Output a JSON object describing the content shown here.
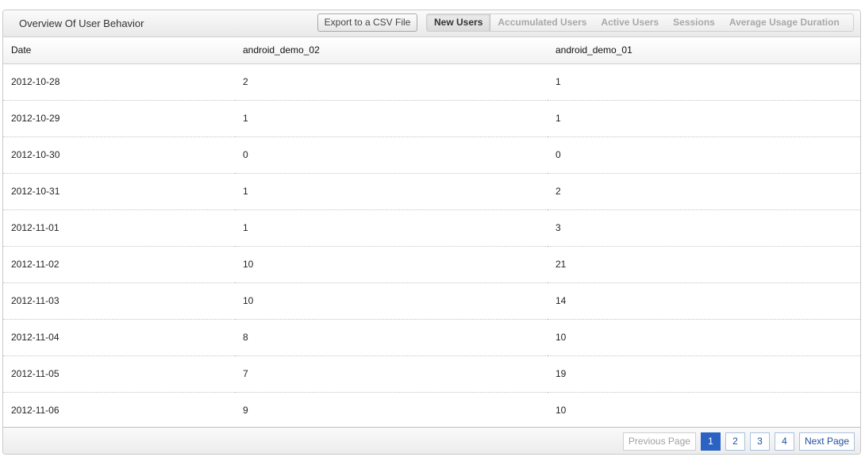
{
  "header": {
    "title": "Overview Of User Behavior",
    "export_label": "Export to a CSV File",
    "tabs": [
      {
        "label": "New Users",
        "active": true
      },
      {
        "label": "Accumulated Users",
        "active": false
      },
      {
        "label": "Active Users",
        "active": false
      },
      {
        "label": "Sessions",
        "active": false
      },
      {
        "label": "Average Usage Duration",
        "active": false
      }
    ]
  },
  "table": {
    "columns": [
      "Date",
      "android_demo_02",
      "android_demo_01"
    ],
    "rows": [
      [
        "2012-10-28",
        "2",
        "1"
      ],
      [
        "2012-10-29",
        "1",
        "1"
      ],
      [
        "2012-10-30",
        "0",
        "0"
      ],
      [
        "2012-10-31",
        "1",
        "2"
      ],
      [
        "2012-11-01",
        "1",
        "3"
      ],
      [
        "2012-11-02",
        "10",
        "21"
      ],
      [
        "2012-11-03",
        "10",
        "14"
      ],
      [
        "2012-11-04",
        "8",
        "10"
      ],
      [
        "2012-11-05",
        "7",
        "19"
      ],
      [
        "2012-11-06",
        "9",
        "10"
      ]
    ]
  },
  "pagination": {
    "previous_label": "Previous Page",
    "pages": [
      "1",
      "2",
      "3",
      "4"
    ],
    "current_page": "1",
    "next_label": "Next Page"
  },
  "colors": {
    "accent": "#2a63c2",
    "link": "#1f4f9b"
  }
}
